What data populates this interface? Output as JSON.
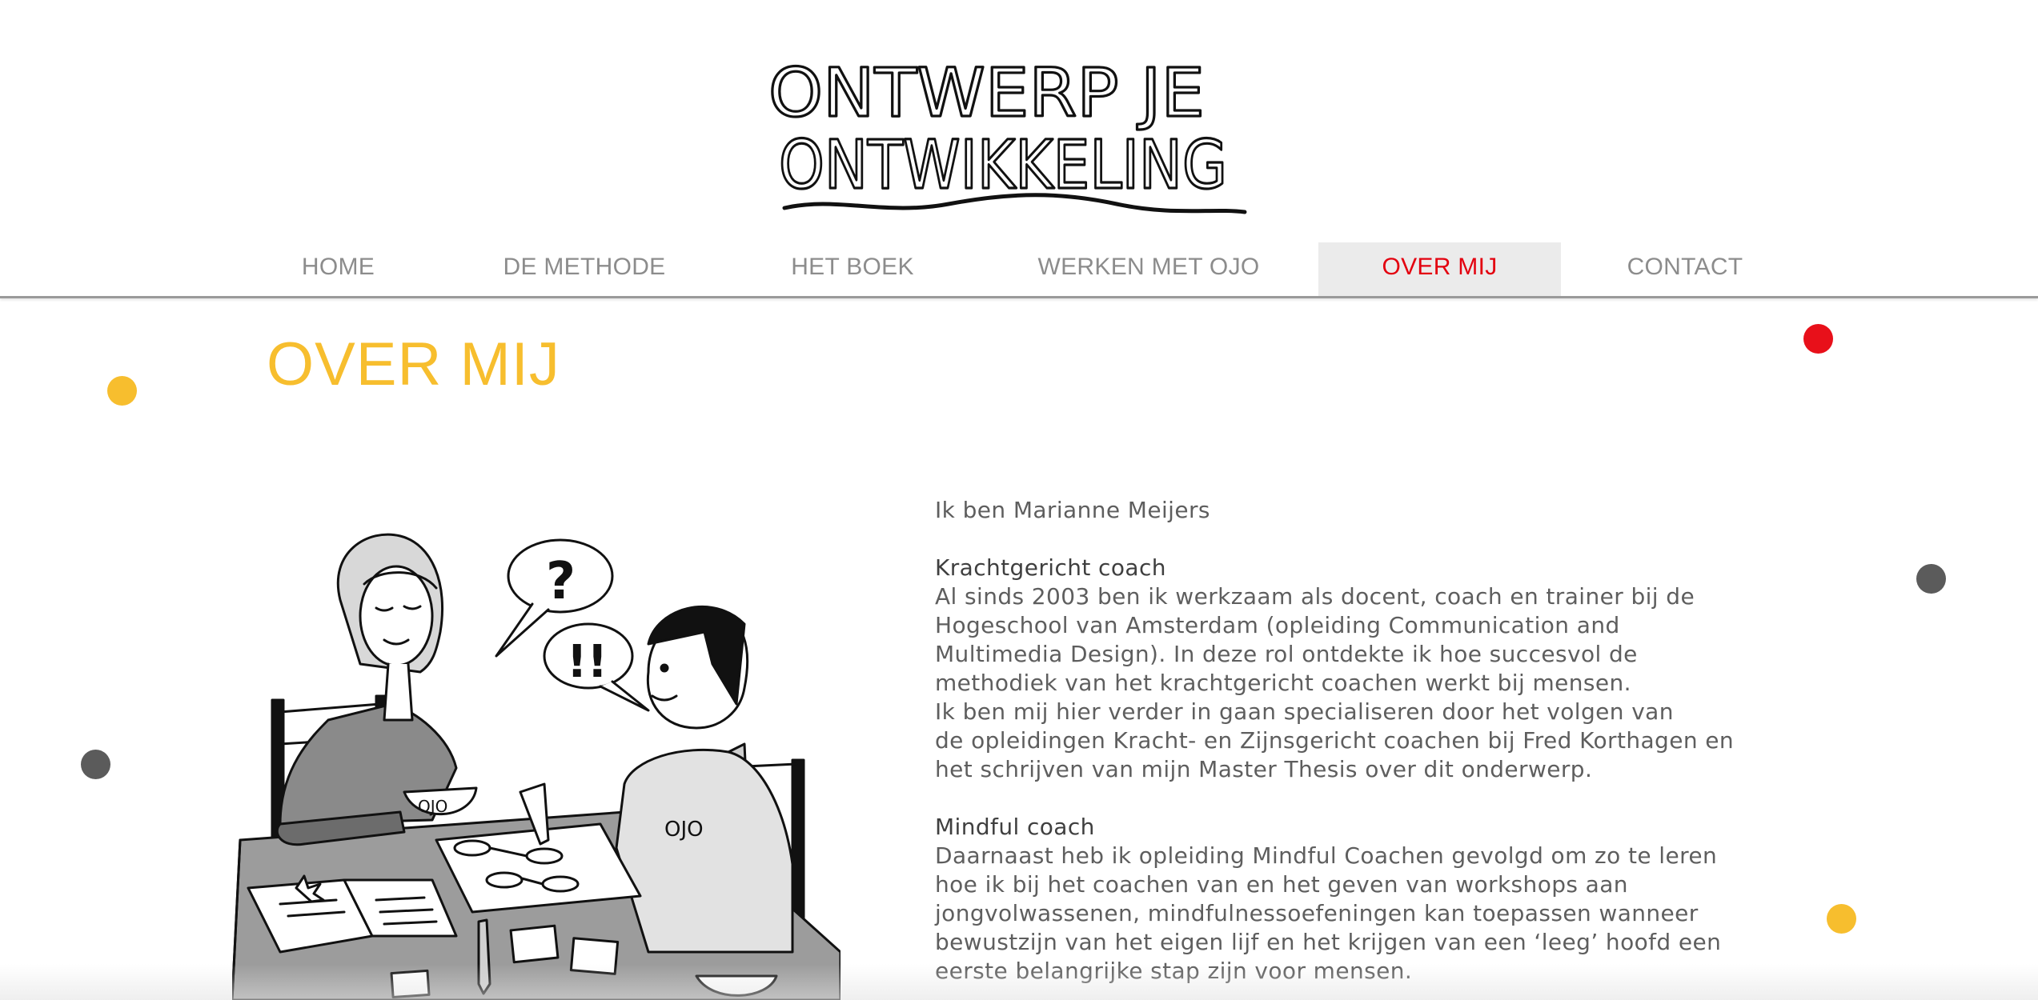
{
  "site": {
    "logo_text_line1": "ONTWERP JE",
    "logo_text_line2": "ONTWIKKELING"
  },
  "nav": {
    "items": [
      {
        "label": "HOME"
      },
      {
        "label": "DE METHODE"
      },
      {
        "label": "HET BOEK"
      },
      {
        "label": "WERKEN MET OJO"
      },
      {
        "label": "OVER MIJ",
        "active": true
      },
      {
        "label": "CONTACT"
      }
    ]
  },
  "page": {
    "title": "OVER MIJ"
  },
  "illustration": {
    "bubble_question": "?",
    "bubble_exclaim": "!!",
    "cup_text": "OJO",
    "shirt_text": "OJO"
  },
  "bio": {
    "intro": "Ik ben Marianne Meijers",
    "section1_heading": "Krachtgericht coach",
    "section1_lines": [
      "Al sinds 2003 ben ik werkzaam als docent, coach en trainer bij de",
      "Hogeschool van Amsterdam (opleiding Communication and",
      "Multimedia Design). In deze rol ontdekte ik hoe succesvol de",
      "methodiek van het krachtgericht coachen werkt bij mensen.",
      "Ik ben mij hier verder in gaan specialiseren door het volgen van",
      "de opleidingen Kracht- en Zijnsgericht coachen bij Fred Korthagen en",
      "het schrijven van mijn Master Thesis over dit onderwerp."
    ],
    "section2_heading": "Mindful coach",
    "section2_lines": [
      "Daarnaast heb ik opleiding Mindful Coachen gevolgd om zo te leren",
      "hoe ik bij het coachen van en het geven van workshops aan",
      "jongvolwassenen, mindfulnessoefeningen kan toepassen wanneer",
      "bewustzijn van het eigen lijf en het krijgen van een ‘leeg’ hoofd een",
      "eerste belangrijke stap zijn voor mensen."
    ]
  },
  "colors": {
    "accent_yellow": "#f7be2e",
    "accent_red": "#e3000f",
    "dot_grey": "#5b5b5b",
    "nav_text": "#8c8c8c",
    "active_bg": "#ebebeb"
  }
}
